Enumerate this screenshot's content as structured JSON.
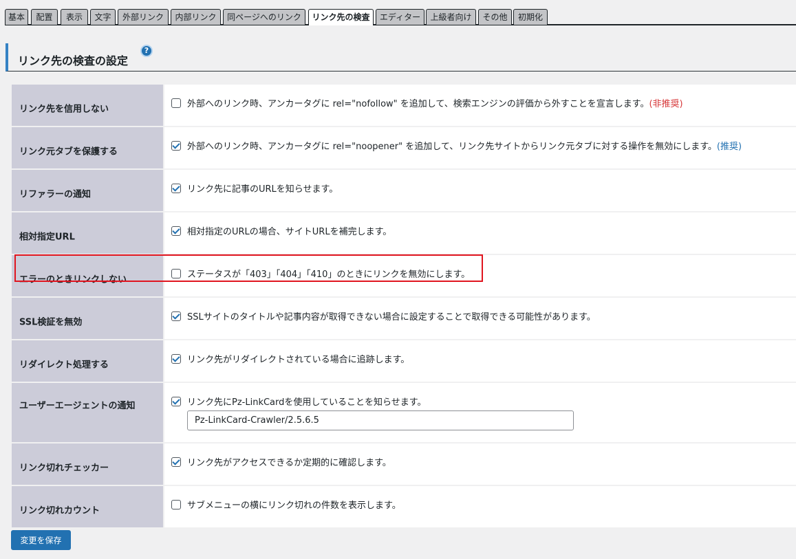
{
  "tabs": [
    {
      "label": "基本"
    },
    {
      "label": "配置"
    },
    {
      "label": "表示"
    },
    {
      "label": "文字"
    },
    {
      "label": "外部リンク"
    },
    {
      "label": "内部リンク"
    },
    {
      "label": "同ページへのリンク"
    },
    {
      "label": "リンク先の検査"
    },
    {
      "label": "エディター"
    },
    {
      "label": "上級者向け"
    },
    {
      "label": "その他"
    },
    {
      "label": "初期化"
    }
  ],
  "active_tab": "リンク先の検査",
  "section": {
    "title": "リンク先の検査の設定",
    "help_icon": "question-circle-icon",
    "help_glyph": "?"
  },
  "rows": [
    {
      "label": "リンク先を信用しない",
      "checked": false,
      "desc": "外部へのリンク時、アンカータグに rel=\"nofollow\" を追加して、検索エンジンの評価から外すことを宣言します。",
      "note": "(非推奨)"
    },
    {
      "label": "リンク元タブを保護する",
      "checked": true,
      "desc": "外部へのリンク時、アンカータグに rel=\"noopener\" を追加して、リンク先サイトからリンク元タブに対する操作を無効にします。",
      "note": "(推奨)"
    },
    {
      "label": "リファラーの通知",
      "checked": true,
      "desc": "リンク先に記事のURLを知らせます。"
    },
    {
      "label": "相対指定URL",
      "checked": true,
      "desc": "相対指定のURLの場合、サイトURLを補完します。"
    },
    {
      "label": "エラーのときリンクしない",
      "checked": false,
      "desc": "ステータスが「403」「404」「410」のときにリンクを無効にします。"
    },
    {
      "label": "SSL検証を無効",
      "checked": true,
      "desc": "SSLサイトのタイトルや記事内容が取得できない場合に設定することで取得できる可能性があります。"
    },
    {
      "label": "リダイレクト処理する",
      "checked": true,
      "desc": "リンク先がリダイレクトされている場合に追跡します。"
    },
    {
      "label": "ユーザーエージェントの通知",
      "checked": true,
      "desc": "リンク先にPz-LinkCardを使用していることを知らせます。",
      "input_value": "Pz-LinkCard-Crawler/2.5.6.5"
    },
    {
      "label": "リンク切れチェッカー",
      "checked": true,
      "desc": "リンク先がアクセスできるか定期的に確認します。"
    },
    {
      "label": "リンク切れカウント",
      "checked": false,
      "desc": "サブメニューの横にリンク切れの件数を表示します。"
    }
  ],
  "save_label": "変更を保存",
  "colors": {
    "accent": "#2271b1",
    "highlight": "#e0141e",
    "label_bg": "#ccccd9",
    "not_recommended": "#d63638",
    "recommended": "#2271b1"
  }
}
